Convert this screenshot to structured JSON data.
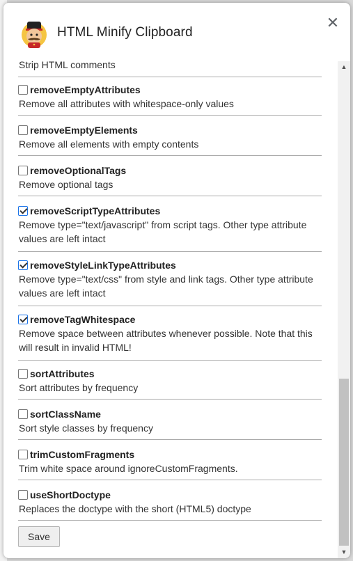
{
  "dialog": {
    "title": "HTML Minify Clipboard",
    "close_label": "✕"
  },
  "cut_off_description": "Strip HTML comments",
  "options": [
    {
      "name": "removeEmptyAttributes",
      "description": "Remove all attributes with whitespace-only values",
      "checked": false
    },
    {
      "name": "removeEmptyElements",
      "description": "Remove all elements with empty contents",
      "checked": false
    },
    {
      "name": "removeOptionalTags",
      "description": "Remove optional tags",
      "checked": false
    },
    {
      "name": "removeScriptTypeAttributes",
      "description": "Remove type=\"text/javascript\" from script tags. Other type attribute values are left intact",
      "checked": true
    },
    {
      "name": "removeStyleLinkTypeAttributes",
      "description": "Remove type=\"text/css\" from style and link tags. Other type attribute values are left intact",
      "checked": true
    },
    {
      "name": "removeTagWhitespace",
      "description": "Remove space between attributes whenever possible. Note that this will result in invalid HTML!",
      "checked": true
    },
    {
      "name": "sortAttributes",
      "description": "Sort attributes by frequency",
      "checked": false
    },
    {
      "name": "sortClassName",
      "description": "Sort style classes by frequency",
      "checked": false
    },
    {
      "name": "trimCustomFragments",
      "description": "Trim white space around ignoreCustomFragments.",
      "checked": false
    },
    {
      "name": "useShortDoctype",
      "description": "Replaces the doctype with the short (HTML5) doctype",
      "checked": false
    }
  ],
  "save_label": "Save",
  "scrollbar": {
    "up_icon": "▲",
    "down_icon": "▼",
    "position": 0.87
  }
}
